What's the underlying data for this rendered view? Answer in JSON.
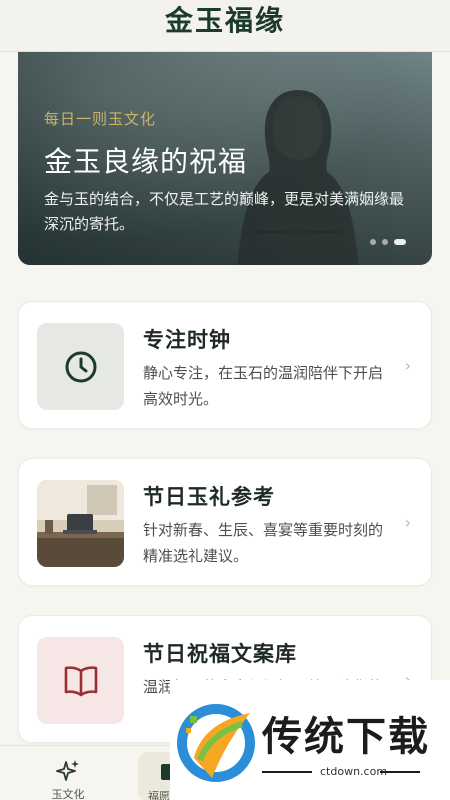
{
  "header": {
    "title": "金玉福缘"
  },
  "hero": {
    "kicker": "每日一则玉文化",
    "title": "金玉良缘的祝福",
    "description": "金与玉的结合，不仅是工艺的巅峰，更是对美满姻缘最深沉的寄托。"
  },
  "cards": [
    {
      "title": "专注时钟",
      "description": "静心专注，在玉石的温润陪伴下开启高效时光。",
      "icon": "clock-icon"
    },
    {
      "title": "节日玉礼参考",
      "description": "针对新春、生辰、喜宴等重要时刻的精准选礼建议。",
      "icon": "desk-photo"
    },
    {
      "title": "节日祝福文案库",
      "description": "温润如玉的文字与祝福写给，让您的",
      "icon": "book-icon"
    }
  ],
  "bottom_nav": {
    "items": [
      {
        "label": "玉文化",
        "icon": "sparkle-icon"
      },
      {
        "label": "福愿",
        "icon": "bookmark-icon"
      }
    ]
  },
  "watermark": {
    "brand": "传统下载",
    "url": "ctdown.com"
  },
  "colors": {
    "accent": "#1d3b2c",
    "gold": "#c9b46a",
    "background": "#f6f5ef",
    "card": "#ffffff"
  }
}
